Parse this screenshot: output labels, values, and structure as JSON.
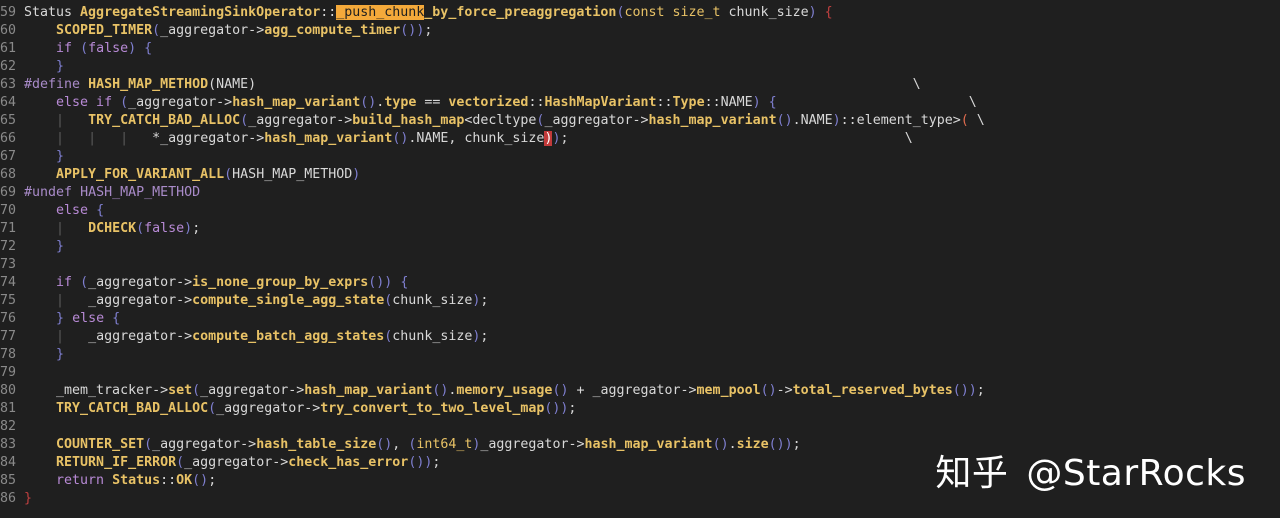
{
  "editor": {
    "lines": [
      {
        "n": "59",
        "tokens": [
          [
            "",
            "Status "
          ],
          [
            "fn",
            "AggregateStreamingSinkOperator"
          ],
          [
            "",
            "::"
          ],
          [
            "search",
            "_push_chunk"
          ],
          [
            "fn",
            "_by_force_preaggregation"
          ],
          [
            "paren",
            "("
          ],
          [
            "type",
            "const size_t"
          ],
          [
            "",
            " chunk_size"
          ],
          [
            "paren",
            ")"
          ],
          [
            "",
            " "
          ],
          [
            "brace",
            "{"
          ]
        ]
      },
      {
        "n": "60",
        "tokens": [
          [
            "",
            "    "
          ],
          [
            "fn",
            "SCOPED_TIMER"
          ],
          [
            "paren",
            "("
          ],
          [
            "",
            "_aggregator->"
          ],
          [
            "fn",
            "agg_compute_timer"
          ],
          [
            "paren",
            "()"
          ],
          [
            "paren",
            ")"
          ],
          [
            "",
            ";"
          ]
        ]
      },
      {
        "n": "61",
        "tokens": [
          [
            "",
            "    "
          ],
          [
            "kw",
            "if"
          ],
          [
            "",
            " "
          ],
          [
            "paren",
            "("
          ],
          [
            "kw",
            "false"
          ],
          [
            "paren",
            ")"
          ],
          [
            "",
            " "
          ],
          [
            "paren",
            "{"
          ]
        ]
      },
      {
        "n": "62",
        "tokens": [
          [
            "",
            "    "
          ],
          [
            "paren",
            "}"
          ]
        ]
      },
      {
        "n": "63",
        "tokens": [
          [
            "kwpp",
            "#define"
          ],
          [
            "",
            " "
          ],
          [
            "fn",
            "HASH_MAP_METHOD"
          ],
          [
            "",
            "(NAME)                                                                                  \\"
          ]
        ]
      },
      {
        "n": "64",
        "tokens": [
          [
            "",
            "    "
          ],
          [
            "kw",
            "else if"
          ],
          [
            "",
            " "
          ],
          [
            "paren",
            "("
          ],
          [
            "",
            "_aggregator->"
          ],
          [
            "fn",
            "hash_map_variant"
          ],
          [
            "paren",
            "()"
          ],
          [
            "",
            "."
          ],
          [
            "fn",
            "type"
          ],
          [
            "",
            " == "
          ],
          [
            "fn",
            "vectorized"
          ],
          [
            "",
            "::"
          ],
          [
            "fn",
            "HashMapVariant"
          ],
          [
            "",
            "::"
          ],
          [
            "fn",
            "Type"
          ],
          [
            "",
            "::NAME"
          ],
          [
            "paren",
            ")"
          ],
          [
            "",
            " "
          ],
          [
            "paren",
            "{"
          ],
          [
            "",
            "                        \\"
          ]
        ]
      },
      {
        "n": "65",
        "tokens": [
          [
            "",
            "    "
          ],
          [
            "guide",
            "|"
          ],
          [
            "",
            "   "
          ],
          [
            "fn",
            "TRY_CATCH_BAD_ALLOC"
          ],
          [
            "paren",
            "("
          ],
          [
            "",
            "_aggregator->"
          ],
          [
            "fn",
            "build_hash_map"
          ],
          [
            "",
            "<decltype"
          ],
          [
            "paren",
            "("
          ],
          [
            "",
            "_aggregator->"
          ],
          [
            "fn",
            "hash_map_variant"
          ],
          [
            "paren",
            "()"
          ],
          [
            "",
            ".NAME"
          ],
          [
            "paren",
            ")"
          ],
          [
            "",
            "::element_type>"
          ],
          [
            "op",
            "("
          ],
          [
            "",
            " \\"
          ]
        ]
      },
      {
        "n": "66",
        "tokens": [
          [
            "",
            "    "
          ],
          [
            "guide",
            "|"
          ],
          [
            "",
            "   "
          ],
          [
            "guide",
            "|"
          ],
          [
            "",
            "   "
          ],
          [
            "guide",
            "|"
          ],
          [
            "",
            "   *_aggregator->"
          ],
          [
            "fn",
            "hash_map_variant"
          ],
          [
            "paren",
            "()"
          ],
          [
            "",
            ".NAME, chunk_size"
          ],
          [
            "match",
            ")"
          ],
          [
            "paren",
            ")"
          ],
          [
            "",
            ";                                          \\"
          ]
        ]
      },
      {
        "n": "67",
        "tokens": [
          [
            "",
            "    "
          ],
          [
            "paren",
            "}"
          ]
        ]
      },
      {
        "n": "68",
        "tokens": [
          [
            "",
            "    "
          ],
          [
            "fn",
            "APPLY_FOR_VARIANT_ALL"
          ],
          [
            "paren",
            "("
          ],
          [
            "",
            "HASH_MAP_METHOD"
          ],
          [
            "paren",
            ")"
          ]
        ]
      },
      {
        "n": "69",
        "tokens": [
          [
            "kwpp",
            "#undef"
          ],
          [
            "",
            " "
          ],
          [
            "kwpp",
            "HASH_MAP_METHOD"
          ]
        ]
      },
      {
        "n": "70",
        "tokens": [
          [
            "",
            "    "
          ],
          [
            "kw",
            "else"
          ],
          [
            "",
            " "
          ],
          [
            "paren",
            "{"
          ]
        ]
      },
      {
        "n": "71",
        "tokens": [
          [
            "",
            "    "
          ],
          [
            "guide",
            "|"
          ],
          [
            "",
            "   "
          ],
          [
            "fn",
            "DCHECK"
          ],
          [
            "paren",
            "("
          ],
          [
            "kw",
            "false"
          ],
          [
            "paren",
            ")"
          ],
          [
            "",
            ";"
          ]
        ]
      },
      {
        "n": "72",
        "tokens": [
          [
            "",
            "    "
          ],
          [
            "paren",
            "}"
          ]
        ]
      },
      {
        "n": "73",
        "tokens": [
          [
            "",
            ""
          ]
        ]
      },
      {
        "n": "74",
        "tokens": [
          [
            "",
            "    "
          ],
          [
            "kw",
            "if"
          ],
          [
            "",
            " "
          ],
          [
            "paren",
            "("
          ],
          [
            "",
            "_aggregator->"
          ],
          [
            "fn",
            "is_none_group_by_exprs"
          ],
          [
            "paren",
            "()"
          ],
          [
            "paren",
            ")"
          ],
          [
            "",
            " "
          ],
          [
            "paren",
            "{"
          ]
        ]
      },
      {
        "n": "75",
        "tokens": [
          [
            "",
            "    "
          ],
          [
            "guide",
            "|"
          ],
          [
            "",
            "   _aggregator->"
          ],
          [
            "fn",
            "compute_single_agg_state"
          ],
          [
            "paren",
            "("
          ],
          [
            "",
            "chunk_size"
          ],
          [
            "paren",
            ")"
          ],
          [
            "",
            ";"
          ]
        ]
      },
      {
        "n": "76",
        "tokens": [
          [
            "",
            "    "
          ],
          [
            "paren",
            "}"
          ],
          [
            "",
            " "
          ],
          [
            "kw",
            "else"
          ],
          [
            "",
            " "
          ],
          [
            "paren",
            "{"
          ]
        ]
      },
      {
        "n": "77",
        "tokens": [
          [
            "",
            "    "
          ],
          [
            "guide",
            "|"
          ],
          [
            "",
            "   _aggregator->"
          ],
          [
            "fn",
            "compute_batch_agg_states"
          ],
          [
            "paren",
            "("
          ],
          [
            "",
            "chunk_size"
          ],
          [
            "paren",
            ")"
          ],
          [
            "",
            ";"
          ]
        ]
      },
      {
        "n": "78",
        "tokens": [
          [
            "",
            "    "
          ],
          [
            "paren",
            "}"
          ]
        ]
      },
      {
        "n": "79",
        "tokens": [
          [
            "",
            ""
          ]
        ]
      },
      {
        "n": "80",
        "tokens": [
          [
            "",
            "    _mem_tracker->"
          ],
          [
            "fn",
            "set"
          ],
          [
            "paren",
            "("
          ],
          [
            "",
            "_aggregator->"
          ],
          [
            "fn",
            "hash_map_variant"
          ],
          [
            "paren",
            "()"
          ],
          [
            "",
            "."
          ],
          [
            "fn",
            "memory_usage"
          ],
          [
            "paren",
            "()"
          ],
          [
            "",
            " + _aggregator->"
          ],
          [
            "fn",
            "mem_pool"
          ],
          [
            "paren",
            "()"
          ],
          [
            "",
            "->"
          ],
          [
            "fn",
            "total_reserved_bytes"
          ],
          [
            "paren",
            "()"
          ],
          [
            "paren",
            ")"
          ],
          [
            "",
            ";"
          ]
        ]
      },
      {
        "n": "81",
        "tokens": [
          [
            "",
            "    "
          ],
          [
            "fn",
            "TRY_CATCH_BAD_ALLOC"
          ],
          [
            "paren",
            "("
          ],
          [
            "",
            "_aggregator->"
          ],
          [
            "fn",
            "try_convert_to_two_level_map"
          ],
          [
            "paren",
            "()"
          ],
          [
            "paren",
            ")"
          ],
          [
            "",
            ";"
          ]
        ]
      },
      {
        "n": "82",
        "tokens": [
          [
            "",
            ""
          ]
        ]
      },
      {
        "n": "83",
        "tokens": [
          [
            "",
            "    "
          ],
          [
            "fn",
            "COUNTER_SET"
          ],
          [
            "paren",
            "("
          ],
          [
            "",
            "_aggregator->"
          ],
          [
            "fn",
            "hash_table_size"
          ],
          [
            "paren",
            "()"
          ],
          [
            "",
            ", "
          ],
          [
            "paren",
            "("
          ],
          [
            "type",
            "int64_t"
          ],
          [
            "paren",
            ")"
          ],
          [
            "",
            "_aggregator->"
          ],
          [
            "fn",
            "hash_map_variant"
          ],
          [
            "paren",
            "()"
          ],
          [
            "",
            "."
          ],
          [
            "fn",
            "size"
          ],
          [
            "paren",
            "()"
          ],
          [
            "paren",
            ")"
          ],
          [
            "",
            ";"
          ]
        ]
      },
      {
        "n": "84",
        "tokens": [
          [
            "",
            "    "
          ],
          [
            "fn",
            "RETURN_IF_ERROR"
          ],
          [
            "paren",
            "("
          ],
          [
            "",
            "_aggregator->"
          ],
          [
            "fn",
            "check_has_error"
          ],
          [
            "paren",
            "()"
          ],
          [
            "paren",
            ")"
          ],
          [
            "",
            ";"
          ]
        ]
      },
      {
        "n": "85",
        "tokens": [
          [
            "",
            "    "
          ],
          [
            "kw",
            "return"
          ],
          [
            "",
            " "
          ],
          [
            "fn",
            "Status"
          ],
          [
            "",
            "::"
          ],
          [
            "fn",
            "OK"
          ],
          [
            "paren",
            "()"
          ],
          [
            "",
            ";"
          ]
        ]
      },
      {
        "n": "86",
        "tokens": [
          [
            "brace",
            "}"
          ]
        ]
      }
    ]
  },
  "watermark": {
    "logo": "知乎",
    "handle": "@StarRocks"
  }
}
